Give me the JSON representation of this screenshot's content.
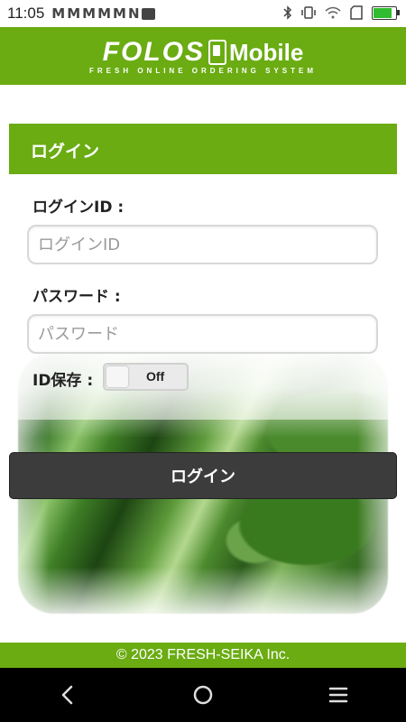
{
  "status_bar": {
    "time": "11:05",
    "notification_icons": [
      "M",
      "M",
      "M",
      "M",
      "M",
      "N"
    ],
    "icons": [
      "gallery-icon",
      "bluetooth-icon",
      "vibrate-icon",
      "wifi-icon",
      "sim-icon",
      "battery-icon"
    ],
    "battery_color": "#2ebd2e"
  },
  "header": {
    "logo_text": "FOLOS",
    "logo_suffix": "Mobile",
    "logo_subtitle": "FRESH ONLINE ORDERING SYSTEM",
    "background_color": "#6aac12"
  },
  "login": {
    "section_title": "ログイン",
    "id_label": "ログインID :",
    "id_placeholder": "ログインID",
    "id_value": "",
    "password_label": "パスワード :",
    "password_placeholder": "パスワード",
    "password_value": "",
    "save_id_label": "ID保存 :",
    "save_id_toggle": "Off",
    "submit_label": "ログイン"
  },
  "footer": {
    "copyright": "© 2023 FRESH-SEIKA Inc."
  },
  "nav": {
    "buttons": [
      "back-icon",
      "home-icon",
      "menu-icon"
    ]
  }
}
